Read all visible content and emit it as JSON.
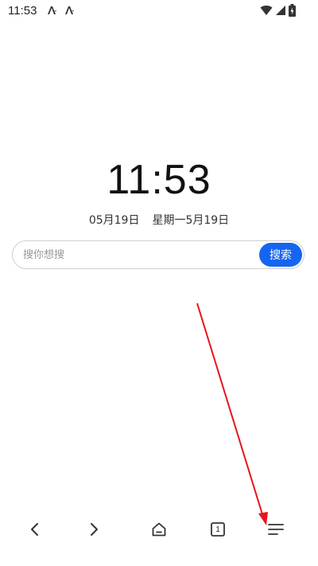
{
  "status_bar": {
    "time": "11:53",
    "notification_icons": [
      "app-notification-icon",
      "app-notification-icon"
    ],
    "right_icons": [
      "wifi-icon",
      "signal-icon",
      "battery-charging-icon"
    ]
  },
  "clock": {
    "time": "11:53",
    "date": "05月19日",
    "lunar_date": "星期一5月19日"
  },
  "search": {
    "placeholder": "搜你想搜",
    "value": "",
    "button_label": "搜索",
    "accent_color": "#1565f0"
  },
  "bottom_nav": {
    "items": [
      {
        "name": "back",
        "icon": "chevron-left-icon"
      },
      {
        "name": "forward",
        "icon": "chevron-right-icon"
      },
      {
        "name": "home",
        "icon": "home-icon"
      },
      {
        "name": "tabs",
        "icon": "tabs-icon",
        "count": "1"
      },
      {
        "name": "menu",
        "icon": "menu-icon"
      }
    ]
  },
  "annotation": {
    "color": "#e8141b"
  }
}
